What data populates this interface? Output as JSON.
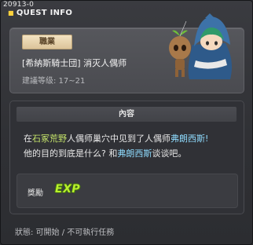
{
  "window": {
    "quest_id": "20913-0",
    "title": "QUEST INFO",
    "title_icon": "bullet-icon"
  },
  "summary": {
    "job_label": "職業",
    "quest_name": "[希納斯騎士団] 消灭人偶师",
    "level_text": "建議等级: 17~21",
    "npc_icon": "hooded-npc-with-wooden-doll"
  },
  "content": {
    "header": "內容",
    "desc_line1_part1": "在",
    "desc_line1_place": "石冢荒野",
    "desc_line1_part2": "人偶师巢穴中见到了人偶师",
    "desc_line1_npc": "弗朗西斯",
    "desc_line1_end": "!",
    "desc_line2_part1": "他的目的到底是什么? 和",
    "desc_line2_npc": "弗朗西斯",
    "desc_line2_part2": "谈谈吧。",
    "reward_label": "獎勵",
    "reward_icon_text": "EXP"
  },
  "status": {
    "text": "狀態: 可開始 / 不可執行任務"
  },
  "colors": {
    "place_highlight": "#c4e36a",
    "npc_highlight": "#8fdcff",
    "exp_green": "#b8f02c",
    "background": "#2b2c30"
  }
}
